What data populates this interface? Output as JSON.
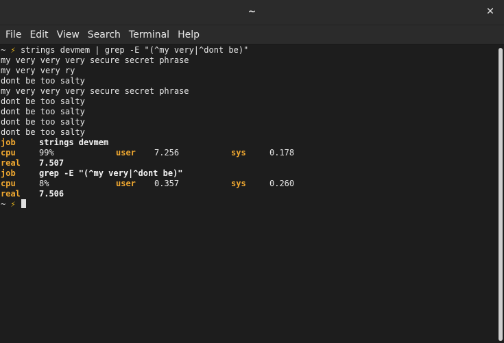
{
  "window": {
    "title": "~",
    "close_glyph": "✕"
  },
  "menu": [
    "File",
    "Edit",
    "View",
    "Search",
    "Terminal",
    "Help"
  ],
  "prompt": {
    "dir": "~",
    "icon": "lightning-bolt-icon",
    "glyph": "⚡"
  },
  "command": "strings devmem | grep -E \"(^my very|^dont be)\"",
  "output": [
    "my very very very secure secret phrase",
    "my very very ry",
    "dont be too salty",
    "my very very very secure secret phrase",
    "dont be too salty",
    "dont be too salty",
    "dont be too salty",
    "dont be too salty"
  ],
  "timings": [
    {
      "job_label": "job",
      "job_cmd": "strings devmem",
      "cpu_label": "cpu",
      "cpu": "99%",
      "user_label": "user",
      "user": "7.256",
      "sys_label": "sys",
      "sys": "0.178",
      "real_label": "real",
      "real": "7.507"
    },
    {
      "job_label": "job",
      "job_cmd": "grep -E \"(^my very|^dont be)\"",
      "cpu_label": "cpu",
      "cpu": "8%",
      "user_label": "user",
      "user": "0.357",
      "sys_label": "sys",
      "sys": "0.260",
      "real_label": "real",
      "real": "7.506"
    }
  ],
  "colors": {
    "background": "#1d1d1d",
    "accent": "#f0a830",
    "bolt": "#f4bf1c",
    "text": "#e8e8e8"
  }
}
